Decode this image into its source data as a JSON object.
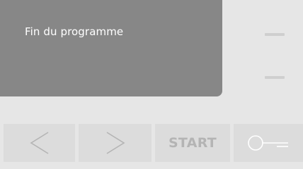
{
  "display": {
    "status_text": "Fin du programme"
  },
  "controls": {
    "start_label": "START"
  },
  "icons": {
    "previous": "chevron-left-icon",
    "next": "chevron-right-icon",
    "lock": "key-lock-icon"
  },
  "colors": {
    "background": "#e6e6e6",
    "display_panel": "#878787",
    "display_text": "#ffffff",
    "indicator": "#cfcfcf",
    "button_face": "#dcdcdc",
    "button_glyph": "#b4b4b4"
  }
}
